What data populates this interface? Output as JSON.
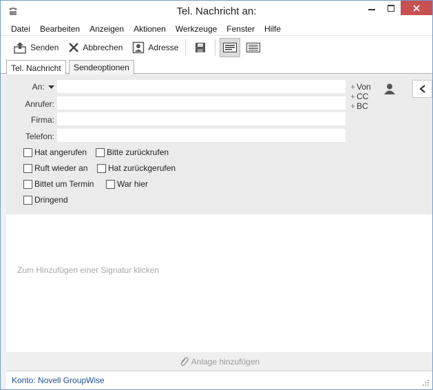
{
  "window": {
    "title": "Tel. Nachricht an:"
  },
  "menu": [
    "Datei",
    "Bearbeiten",
    "Anzeigen",
    "Aktionen",
    "Werkzeuge",
    "Fenster",
    "Hilfe"
  ],
  "toolbar": {
    "send_label": "Senden",
    "cancel_label": "Abbrechen",
    "address_label": "Adresse"
  },
  "tabs": [
    "Tel. Nachricht",
    "Sendeoptionen"
  ],
  "fields": {
    "to_label": "An:",
    "caller_label": "Anrufer:",
    "company_label": "Firma:",
    "phone_label": "Telefon:",
    "to_value": "",
    "caller_value": "",
    "company_value": "",
    "phone_value": ""
  },
  "side_links": [
    "Von",
    "CC",
    "BC"
  ],
  "checkboxes": [
    {
      "label": "Hat angerufen",
      "checked": false
    },
    {
      "label": "Bitte zurückrufen",
      "checked": false
    },
    {
      "label": "Ruft wieder an",
      "checked": false
    },
    {
      "label": "Hat zurückgerufen",
      "checked": false
    },
    {
      "label": "Bittet um Termin",
      "checked": false
    },
    {
      "label": "War hier",
      "checked": false
    },
    {
      "label": "Dringend",
      "checked": false
    }
  ],
  "body": {
    "signature_hint": "Zum Hinzufügen einer Signatur klicken"
  },
  "attach": {
    "label": "Anlage hinzufügen"
  },
  "status": {
    "text": "Konto: Novell GroupWise"
  },
  "colors": {
    "close_button": "#c75050",
    "status_text": "#1f4f8f",
    "address_bg": "#ebebeb"
  }
}
